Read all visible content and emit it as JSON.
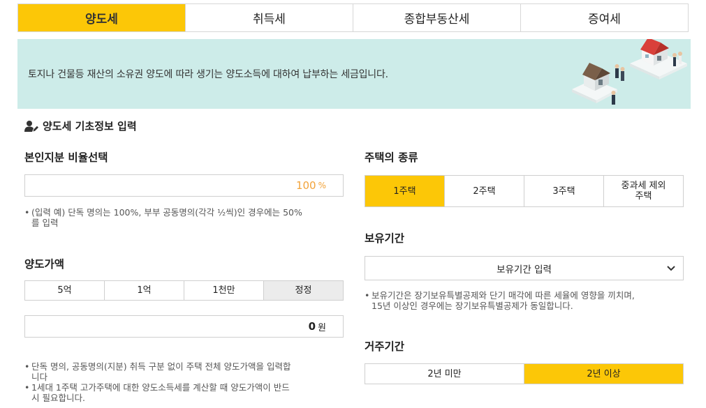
{
  "tabs": [
    {
      "label": "양도세",
      "active": true
    },
    {
      "label": "취득세",
      "active": false
    },
    {
      "label": "종합부동산세",
      "active": false
    },
    {
      "label": "증여세",
      "active": false
    }
  ],
  "banner": {
    "text": "토지나 건물등 재산의 소유권 양도에 따라 생기는 양도소득에 대하여 납부하는 세금입니다."
  },
  "section": {
    "title": "양도세 기초정보 입력",
    "icon": "user-edit-icon"
  },
  "ownership": {
    "label": "본인지분 비율선택",
    "value": "100",
    "unit": "%",
    "value_color": "#f2a33a",
    "note_lines": [
      "(입력 예) 단독 명의는 100%, 부부 공동명의(각각 ½씩)인 경우에는 50%",
      "를 입력"
    ]
  },
  "price": {
    "label": "양도가액",
    "buttons": [
      "5억",
      "1억",
      "1천만",
      "정정"
    ],
    "value": "0",
    "unit": "원",
    "notes": [
      [
        "단독 명의, 공동명의(지분) 취득 구분 없이 주택 전체 양도가액을 입력합",
        "니다"
      ],
      [
        "1세대 1주택 고가주택에 대한 양도소득세를 계산할 때 양도가액이 반드",
        "시 필요합니다."
      ]
    ]
  },
  "house_type": {
    "label": "주택의 종류",
    "options": [
      {
        "line1": "1주택",
        "line2": "",
        "active": true
      },
      {
        "line1": "2주택",
        "line2": "",
        "active": false
      },
      {
        "line1": "3주택",
        "line2": "",
        "active": false
      },
      {
        "line1": "중과세 제외",
        "line2": "주택",
        "active": false
      }
    ]
  },
  "holding": {
    "label": "보유기간",
    "select_text": "보유기간 입력",
    "note_lines": [
      "보유기간은 장기보유특별공제와 단기 매각에 따른 세율에 영향을 끼치며,",
      "15년 이상인 경우에는 장기보유특별공제가 동일합니다."
    ]
  },
  "residence": {
    "label": "거주기간",
    "options": [
      {
        "label": "2년 미만",
        "active": false
      },
      {
        "label": "2년 이상",
        "active": true
      }
    ]
  },
  "colors": {
    "accent": "#fcc707",
    "banner_bg": "#cdece9",
    "border": "#cfcfcf"
  }
}
